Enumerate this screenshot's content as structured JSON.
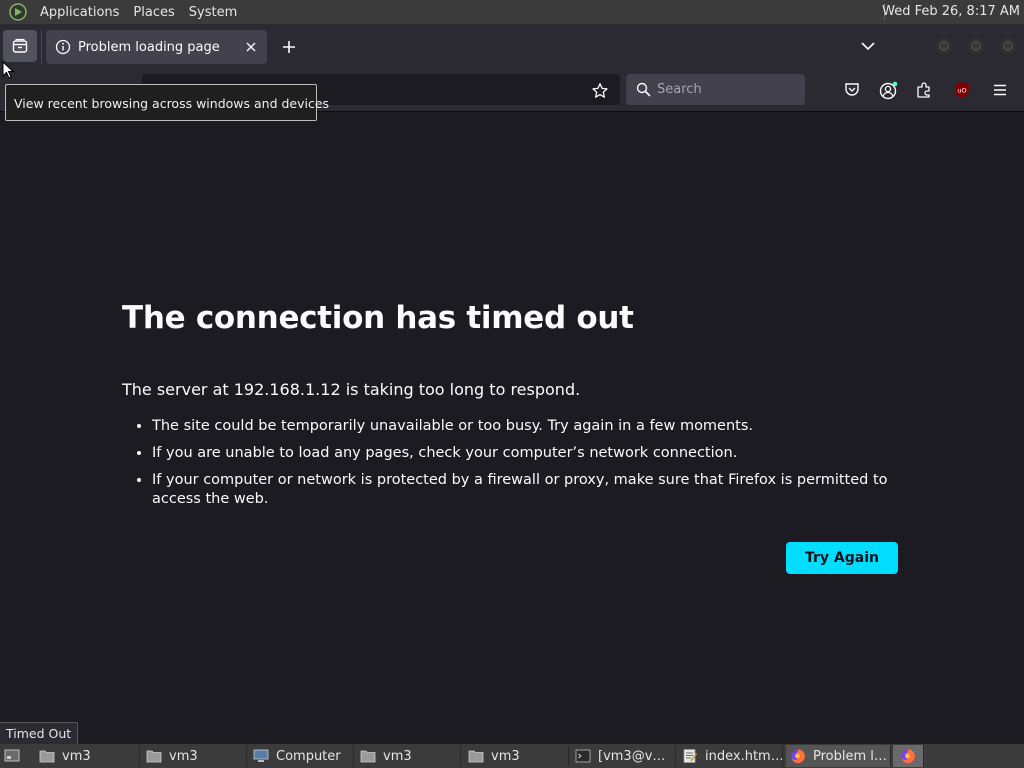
{
  "system_panel": {
    "menus": [
      "Applications",
      "Places",
      "System"
    ],
    "clock": "Wed Feb 26,  8:17 AM"
  },
  "browser": {
    "tab": {
      "title": "Problem loading page"
    },
    "search_placeholder": "Search",
    "tooltip": "View recent browsing across windows and devices",
    "accent_color": "#00ddff"
  },
  "error_page": {
    "title": "The connection has timed out",
    "intro": "The server at 192.168.1.12 is taking too long to respond.",
    "bullets": [
      "The site could be temporarily unavailable or too busy. Try again in a few moments.",
      "If you are unable to load any pages, check your computer’s network connection.",
      "If your computer or network is protected by a firewall or proxy, make sure that Firefox is permitted to access the web."
    ],
    "button": "Try Again"
  },
  "status_text": "Timed Out",
  "taskbar": {
    "items": [
      {
        "label": "vm3",
        "icon": "folder-icon"
      },
      {
        "label": "vm3",
        "icon": "folder-icon"
      },
      {
        "label": "Computer",
        "icon": "computer-icon"
      },
      {
        "label": "vm3",
        "icon": "folder-icon"
      },
      {
        "label": "vm3",
        "icon": "folder-icon"
      },
      {
        "label": "[vm3@v…",
        "icon": "terminal-icon"
      },
      {
        "label": "index.htm…",
        "icon": "text-editor-icon"
      },
      {
        "label": "Problem l…",
        "icon": "firefox-icon"
      }
    ]
  }
}
